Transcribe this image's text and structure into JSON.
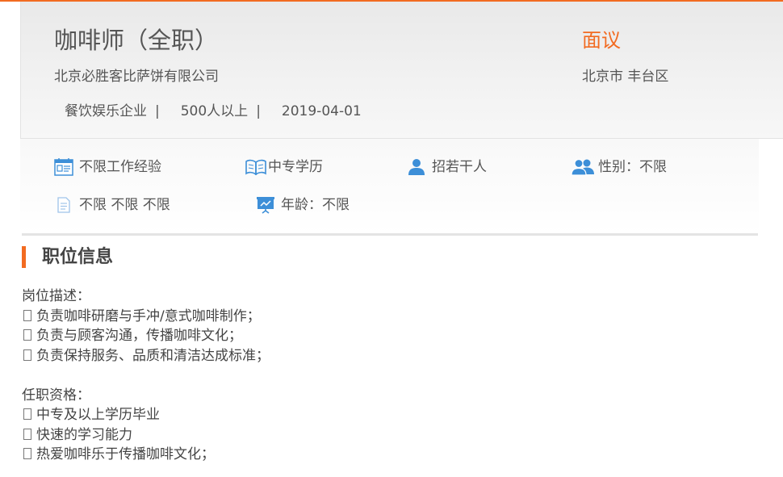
{
  "job": {
    "title": "咖啡师（全职）",
    "salary": "面议",
    "company": "北京必胜客比萨饼有限公司",
    "location": "北京市 丰台区",
    "industry": "餐饮娱乐企业",
    "size": "500人以上",
    "date": "2019-04-01",
    "separator": "|"
  },
  "tags": [
    {
      "icon": "resume-card-icon",
      "label": "不限工作经验"
    },
    {
      "icon": "open-book-icon",
      "label": "中专学历"
    },
    {
      "icon": "person-icon",
      "label": "招若干人"
    },
    {
      "icon": "people-icon",
      "label": "性别：不限"
    },
    {
      "icon": "document-icon",
      "label": "不限 不限 不限"
    },
    {
      "icon": "presentation-board-icon",
      "label": "年龄：不限"
    }
  ],
  "section": {
    "title": "职位信息",
    "description_heading": "岗位描述：",
    "description_items": [
      "负责咖啡研磨与手冲/意式咖啡制作；",
      "负责与顾客沟通，传播咖啡文化；",
      "负责保持服务、品质和清洁达成标准；"
    ],
    "qualification_heading": "任职资格：",
    "qualification_items": [
      "中专及以上学历毕业",
      "快速的学习能力",
      "热爱咖啡乐于传播咖啡文化；"
    ]
  },
  "colors": {
    "accent": "#f26b21",
    "icon_blue": "#3d8fd8",
    "text": "#555555"
  }
}
